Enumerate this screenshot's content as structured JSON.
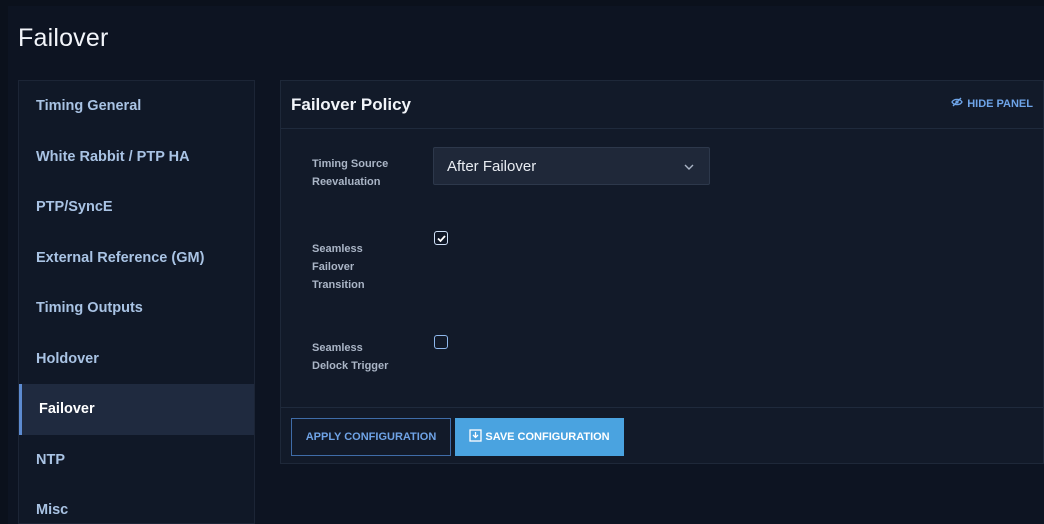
{
  "page": {
    "title": "Failover"
  },
  "sidebar": {
    "items": [
      {
        "label": "Timing General"
      },
      {
        "label": "White Rabbit / PTP HA"
      },
      {
        "label": "PTP/SyncE"
      },
      {
        "label": "External Reference (GM)"
      },
      {
        "label": "Timing Outputs"
      },
      {
        "label": "Holdover"
      },
      {
        "label": "Failover",
        "active": true
      },
      {
        "label": "NTP"
      },
      {
        "label": "Misc"
      }
    ]
  },
  "panel": {
    "title": "Failover Policy",
    "hide_label": "HIDE PANEL",
    "fields": {
      "timing_source": {
        "label_line1": "Timing Source",
        "label_line2": "Reevaluation",
        "value": "After Failover"
      },
      "seamless_failover": {
        "label_line1": "Seamless",
        "label_line2": "Failover",
        "label_line3": "Transition",
        "checked": true
      },
      "seamless_delock": {
        "label_line1": "Seamless",
        "label_line2": "Delock Trigger",
        "checked": false
      }
    },
    "buttons": {
      "apply": "APPLY CONFIGURATION",
      "save": "SAVE CONFIGURATION"
    }
  },
  "colors": {
    "accent": "#4aa3e0",
    "link": "#6ea4e8",
    "background": "#0d1422"
  },
  "icons": {
    "hide_panel": "eye-slash-icon",
    "select": "chevron-down-icon",
    "save": "download-icon",
    "check": "check-icon"
  }
}
